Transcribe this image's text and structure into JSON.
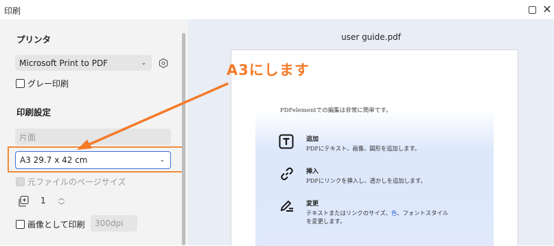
{
  "window": {
    "title": "印刷"
  },
  "printer": {
    "heading": "プリンタ",
    "selected": "Microsoft Print to PDF",
    "grayscale_label": "グレー印刷"
  },
  "settings": {
    "heading": "印刷設定",
    "sides_value": "片面",
    "paper_value": "A3 29.7 x 42 cm",
    "original_size_label": "元ファイルのページサイズ",
    "copies_value": "1",
    "print_as_image_label": "画像として印刷",
    "dpi_value": "300dpi"
  },
  "preview": {
    "file_name": "user guide.pdf",
    "cut_line": "PDFelementでの編集は非常に簡単です。",
    "features": [
      {
        "title": "追加",
        "desc": "PDFにテキスト、画像、図形を追加します。"
      },
      {
        "title": "挿入",
        "desc": "PDFにリンクを挿入し、透かしを追加します。"
      },
      {
        "title": "変更",
        "desc_1": "テキストまたはリンクのサイズ、",
        "desc_hl": "色",
        "desc_2": "、フォントスタイル",
        "desc_3": "を変更します。"
      }
    ]
  },
  "annotation": {
    "text": "A3にします",
    "color": "#f47a28"
  },
  "colors": {
    "accent_border": "#3b6ed8",
    "annotation_frame": "#f08a3c"
  }
}
